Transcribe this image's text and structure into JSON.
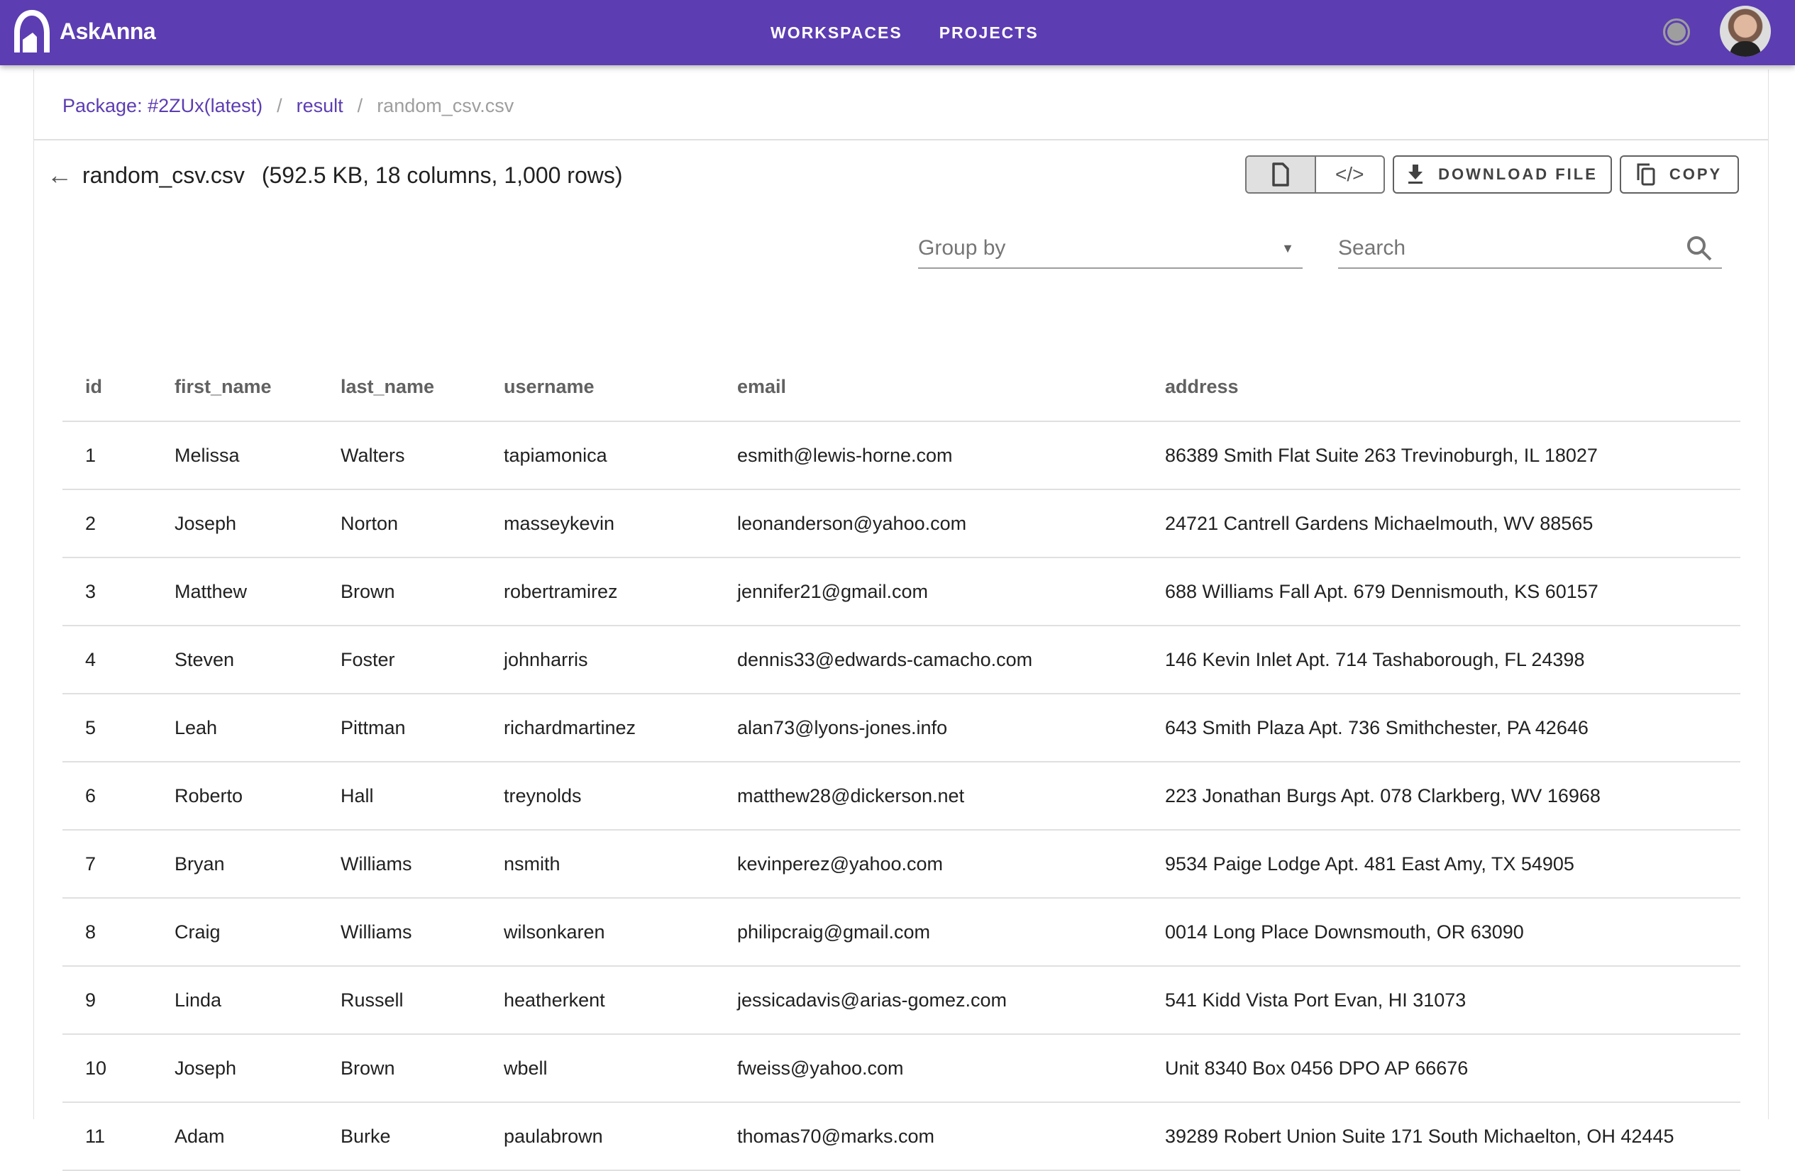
{
  "app": {
    "name": "AskAnna",
    "nav": [
      "WORKSPACES",
      "PROJECTS"
    ]
  },
  "breadcrumb": {
    "items": [
      "Package: #2ZUx(latest)",
      "result"
    ],
    "current": "random_csv.csv",
    "separator": "/"
  },
  "file": {
    "name": "random_csv.csv",
    "meta": "(592.5 KB, 18 columns, 1,000 rows)"
  },
  "toolbar": {
    "download_label": "DOWNLOAD FILE",
    "copy_label": "COPY"
  },
  "filters": {
    "group_by_placeholder": "Group by",
    "search_placeholder": "Search"
  },
  "table": {
    "columns": [
      "id",
      "first_name",
      "last_name",
      "username",
      "email",
      "address"
    ],
    "rows": [
      [
        "1",
        "Melissa",
        "Walters",
        "tapiamonica",
        "esmith@lewis-horne.com",
        "86389 Smith Flat Suite 263 Trevinoburgh, IL 18027"
      ],
      [
        "2",
        "Joseph",
        "Norton",
        "masseykevin",
        "leonanderson@yahoo.com",
        "24721 Cantrell Gardens Michaelmouth, WV 88565"
      ],
      [
        "3",
        "Matthew",
        "Brown",
        "robertramirez",
        "jennifer21@gmail.com",
        "688 Williams Fall Apt. 679 Dennismouth, KS 60157"
      ],
      [
        "4",
        "Steven",
        "Foster",
        "johnharris",
        "dennis33@edwards-camacho.com",
        "146 Kevin Inlet Apt. 714 Tashaborough, FL 24398"
      ],
      [
        "5",
        "Leah",
        "Pittman",
        "richardmartinez",
        "alan73@lyons-jones.info",
        "643 Smith Plaza Apt. 736 Smithchester, PA 42646"
      ],
      [
        "6",
        "Roberto",
        "Hall",
        "treynolds",
        "matthew28@dickerson.net",
        "223 Jonathan Burgs Apt. 078 Clarkberg, WV 16968"
      ],
      [
        "7",
        "Bryan",
        "Williams",
        "nsmith",
        "kevinperez@yahoo.com",
        "9534 Paige Lodge Apt. 481 East Amy, TX 54905"
      ],
      [
        "8",
        "Craig",
        "Williams",
        "wilsonkaren",
        "philipcraig@gmail.com",
        "0014 Long Place Downsmouth, OR 63090"
      ],
      [
        "9",
        "Linda",
        "Russell",
        "heatherkent",
        "jessicadavis@arias-gomez.com",
        "541 Kidd Vista Port Evan, HI 31073"
      ],
      [
        "10",
        "Joseph",
        "Brown",
        "wbell",
        "fweiss@yahoo.com",
        "Unit 8340 Box 0456 DPO AP 66676"
      ],
      [
        "11",
        "Adam",
        "Burke",
        "paulabrown",
        "thomas70@marks.com",
        "39289 Robert Union Suite 171 South Michaelton, OH 42445"
      ]
    ]
  },
  "colors": {
    "brand": "#5c3db2"
  }
}
